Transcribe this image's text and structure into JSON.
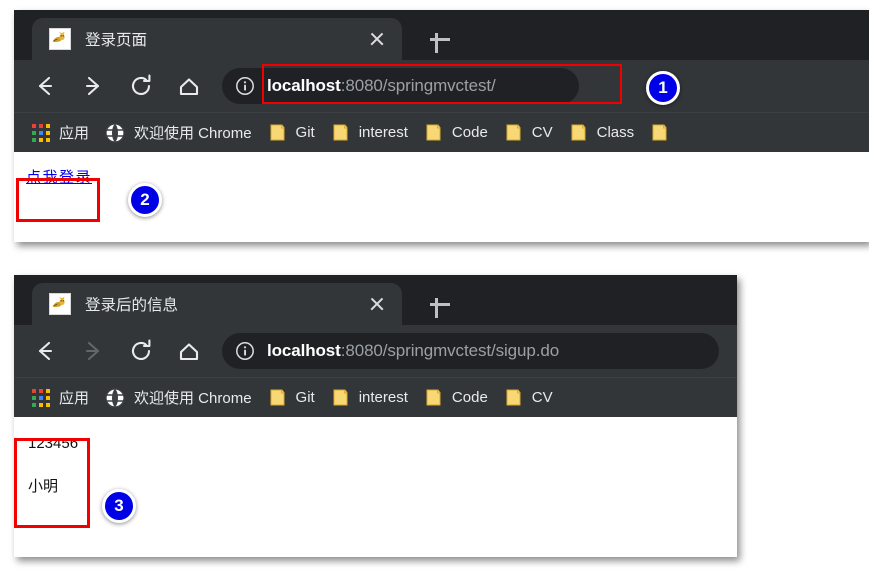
{
  "windows": [
    {
      "id": "login-page-window",
      "tab": {
        "title": "登录页面",
        "favicon": "tomcat-favicon",
        "close_icon": "close-icon",
        "newtab_icon": "new-tab-icon"
      },
      "toolbar": {
        "back_icon": "back-arrow-icon",
        "forward_icon": "forward-arrow-icon",
        "reload_icon": "reload-icon",
        "home_icon": "home-icon",
        "security_icon": "info-circle-icon",
        "url_host": "localhost",
        "url_rest": ":8080/springmvctest/",
        "url_full": "localhost:8080/springmvctest/",
        "forward_enabled": true
      },
      "bookmarks": [
        {
          "icon": "apps-grid-icon",
          "label": "应用"
        },
        {
          "icon": "globe-icon",
          "label": "欢迎使用 Chrome"
        },
        {
          "icon": "folder-icon",
          "label": "Git"
        },
        {
          "icon": "folder-icon",
          "label": "interest"
        },
        {
          "icon": "folder-icon",
          "label": "Code"
        },
        {
          "icon": "folder-icon",
          "label": "CV"
        },
        {
          "icon": "folder-icon",
          "label": "Class"
        },
        {
          "icon": "folder-icon",
          "label": ""
        }
      ],
      "content": {
        "link_label": "点我登录"
      }
    },
    {
      "id": "after-login-window",
      "tab": {
        "title": "登录后的信息",
        "favicon": "tomcat-favicon",
        "close_icon": "close-icon",
        "newtab_icon": "new-tab-icon"
      },
      "toolbar": {
        "back_icon": "back-arrow-icon",
        "forward_icon": "forward-arrow-icon",
        "reload_icon": "reload-icon",
        "home_icon": "home-icon",
        "security_icon": "info-circle-icon",
        "url_host": "localhost",
        "url_rest": ":8080/springmvctest/sigup.do",
        "url_full": "localhost:8080/springmvctest/sigup.do",
        "forward_enabled": false
      },
      "bookmarks": [
        {
          "icon": "apps-grid-icon",
          "label": "应用"
        },
        {
          "icon": "globe-icon",
          "label": "欢迎使用 Chrome"
        },
        {
          "icon": "folder-icon",
          "label": "Git"
        },
        {
          "icon": "folder-icon",
          "label": "interest"
        },
        {
          "icon": "folder-icon",
          "label": "Code"
        },
        {
          "icon": "folder-icon",
          "label": "CV"
        }
      ],
      "content": {
        "line1": "123456",
        "line2": "小明"
      }
    }
  ],
  "annotations": {
    "badges": [
      {
        "number": "1",
        "target": "address-bar-window-1"
      },
      {
        "number": "2",
        "target": "login-link-window-1"
      },
      {
        "number": "3",
        "target": "result-text-window-2"
      }
    ],
    "highlight_color": "#f00000",
    "badge_color": "#0000e6"
  },
  "colors": {
    "chrome_toolbar": "#323639",
    "chrome_tabstrip": "#202124",
    "omnibox_bg": "#202124",
    "text_light": "#e8eaed",
    "url_gray": "#9aa0a6",
    "folder_yellow": "#f8d775",
    "link_blue": "#0000ee"
  }
}
